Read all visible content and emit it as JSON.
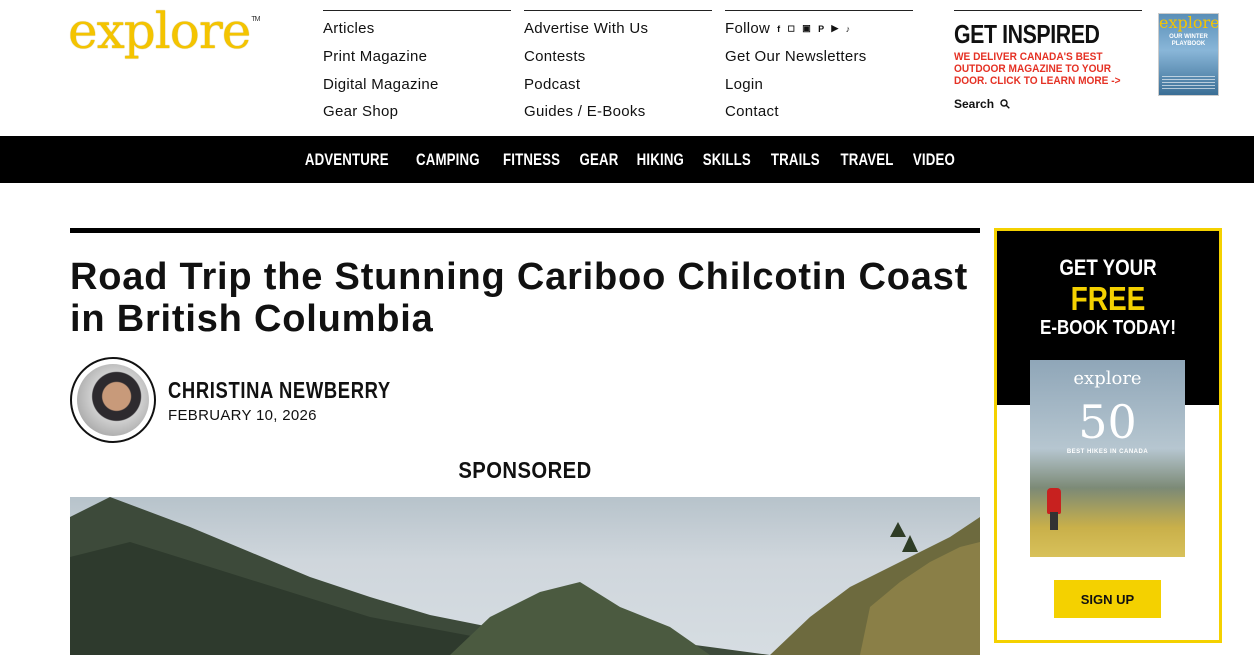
{
  "logo": {
    "text": "explore",
    "tm": "TM"
  },
  "header": {
    "col1": [
      "Articles",
      "Print Magazine",
      "Digital Magazine",
      "Gear Shop"
    ],
    "col2": [
      "Advertise With Us",
      "Contests",
      "Podcast",
      "Guides / E-Books"
    ],
    "col3": {
      "follow": "Follow",
      "links": [
        "Get Our Newsletters",
        "Login",
        "Contact"
      ]
    },
    "social_icons": [
      "facebook-icon",
      "instagram-icon",
      "linkedin-icon",
      "pinterest-icon",
      "youtube-icon",
      "tiktok-icon"
    ],
    "inspired": {
      "title": "GET INSPIRED",
      "text": "WE DELIVER CANADA'S BEST OUTDOOR MAGAZINE TO YOUR DOOR. CLICK TO LEARN MORE ->",
      "search": "Search"
    },
    "magazine": {
      "title": "explore",
      "sub": "OUR WINTER PLAYBOOK"
    }
  },
  "nav": [
    "ADVENTURE",
    "CAMPING",
    "FITNESS",
    "GEAR",
    "HIKING",
    "SKILLS",
    "TRAILS",
    "TRAVEL",
    "VIDEO"
  ],
  "article": {
    "title": "Road Trip the Stunning Cariboo Chilcotin Coast in British Columbia",
    "author": "CHRISTINA NEWBERRY",
    "date": "FEBRUARY 10, 2026",
    "sponsored": "SPONSORED"
  },
  "promo": {
    "line1": "GET YOUR",
    "line2": "FREE",
    "line3": "E-BOOK TODAY!",
    "ebook_title": "explore",
    "ebook_number": "50",
    "ebook_sub": "BEST HIKES IN CANADA",
    "button": "SIGN UP"
  },
  "colors": {
    "brand_yellow": "#f4c400",
    "accent_red": "#e53124",
    "nav_bg": "#000000"
  }
}
